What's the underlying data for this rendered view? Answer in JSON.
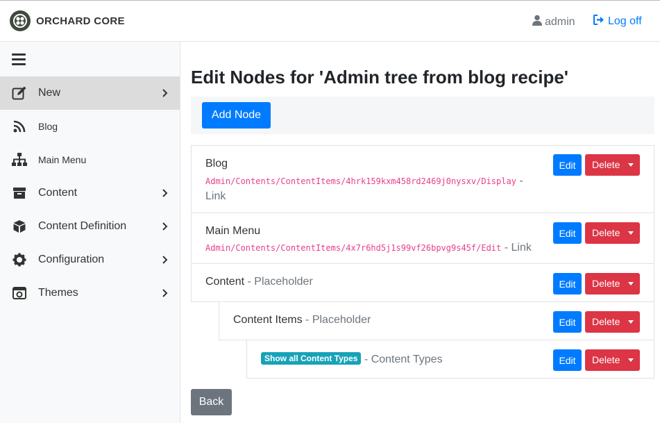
{
  "header": {
    "brand": "ORCHARD CORE",
    "user": "admin",
    "logoff": "Log off"
  },
  "sidebar": {
    "items": [
      {
        "label": "New",
        "icon": "edit-icon",
        "active": true,
        "chevron": true
      },
      {
        "label": "Blog",
        "icon": "rss-icon",
        "active": false,
        "chevron": false
      },
      {
        "label": "Main Menu",
        "icon": "sitemap-icon",
        "active": false,
        "chevron": false
      },
      {
        "label": "Content",
        "icon": "archive-icon",
        "active": false,
        "chevron": true
      },
      {
        "label": "Content Definition",
        "icon": "cube-icon",
        "active": false,
        "chevron": true
      },
      {
        "label": "Configuration",
        "icon": "gear-icon",
        "active": false,
        "chevron": true
      },
      {
        "label": "Themes",
        "icon": "window-icon",
        "active": false,
        "chevron": true
      }
    ]
  },
  "main": {
    "title": "Edit Nodes for 'Admin tree from blog recipe'",
    "add_node": "Add Node",
    "back": "Back",
    "edit_label": "Edit",
    "delete_label": "Delete",
    "nodes": [
      {
        "title": "Blog",
        "url": "Admin/Contents/ContentItems/4hrk159kxm458rd2469j0nysxv/Display",
        "type_sep": " - ",
        "type": "Link"
      },
      {
        "title": "Main Menu",
        "url": "Admin/Contents/ContentItems/4x7r6hd5j1s99vf26bpvg9s45f/Edit",
        "type_sep": " - ",
        "type": "Link"
      },
      {
        "title": "Content",
        "type_sep": " - ",
        "type": "Placeholder"
      },
      {
        "title": "Content Items",
        "type_sep": " - ",
        "type": "Placeholder"
      },
      {
        "badge": "Show all Content Types",
        "type_sep": " - ",
        "type": "Content Types"
      }
    ]
  },
  "colors": {
    "primary": "#007bff",
    "danger": "#dc3545",
    "secondary": "#6c757d",
    "info": "#17a2b8",
    "code": "#e83e8c"
  }
}
